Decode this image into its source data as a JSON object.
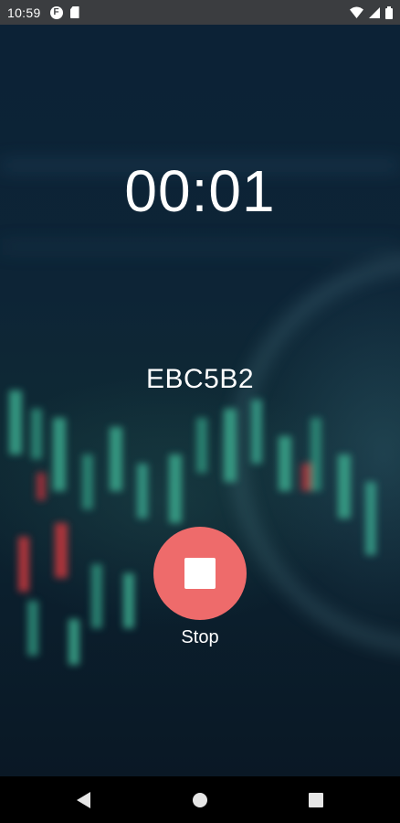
{
  "status_bar": {
    "time": "10:59",
    "left_icons": [
      "notification-f-icon",
      "sd-card-icon"
    ],
    "right_icons": [
      "wifi-icon",
      "signal-icon",
      "battery-icon"
    ]
  },
  "main": {
    "timer": "00:01",
    "code": "EBC5B2",
    "stop_label": "Stop"
  },
  "nav_bar": {
    "icons": [
      "back-icon",
      "home-icon",
      "recents-icon"
    ]
  },
  "colors": {
    "stop_button": "#ee6b6b",
    "status_bar": "#3b3d40",
    "nav_bar": "#000000"
  }
}
